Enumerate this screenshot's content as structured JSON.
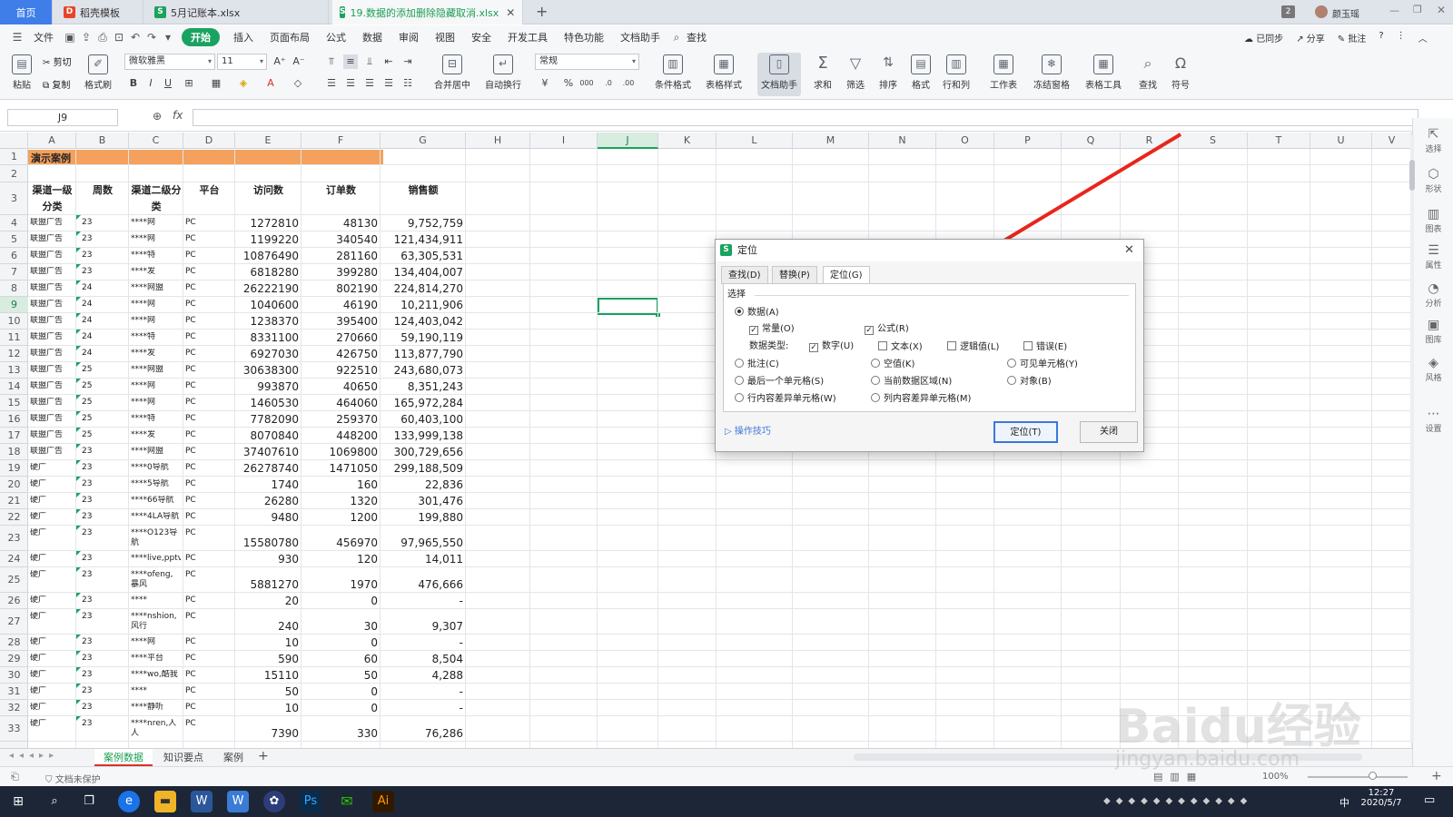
{
  "window_tabs": [
    {
      "label": "首页"
    },
    {
      "label": "稻壳模板"
    },
    {
      "label": "5月记账本.xlsx"
    },
    {
      "label": "19.数据的添加删除隐藏取消.xlsx"
    }
  ],
  "titlebar": {
    "badge": "2",
    "user": "颜玉瑶"
  },
  "menus": [
    "文件",
    "开始",
    "插入",
    "页面布局",
    "公式",
    "数据",
    "审阅",
    "视图",
    "安全",
    "开发工具",
    "特色功能",
    "文档助手",
    "查找"
  ],
  "menu_right": {
    "sync": "已同步",
    "share": "分享",
    "annotate": "批注"
  },
  "ribbon": {
    "paste": "粘贴",
    "cut": "剪切",
    "copy": "复制",
    "format_painter": "格式刷",
    "font_name": "微软雅黑",
    "font_size": "11",
    "number_format": "常规",
    "merge": "合并居中",
    "wrap": "自动换行",
    "cond_format": "条件格式",
    "table_style": "表格样式",
    "doc_assistant": "文档助手",
    "sum": "求和",
    "filter": "筛选",
    "sort": "排序",
    "format": "格式",
    "row_col": "行和列",
    "worksheet": "工作表",
    "freeze": "冻结窗格",
    "table_tools": "表格工具",
    "find": "查找",
    "symbol": "符号"
  },
  "formula_bar": {
    "name_box": "J9",
    "fx": "fx",
    "formula": ""
  },
  "columns": [
    "A",
    "B",
    "C",
    "D",
    "E",
    "F",
    "G",
    "H",
    "I",
    "J",
    "K",
    "L",
    "M",
    "N",
    "O",
    "P",
    "Q",
    "R",
    "S",
    "T",
    "U",
    "V"
  ],
  "selected_col": "J",
  "selected_row": "9",
  "banner": "演示案例",
  "headers": {
    "a": "渠道一级分类",
    "b": "周数",
    "c": "渠道二级分类",
    "d": "平台",
    "e": "访问数",
    "f": "订单数",
    "g": "销售额"
  },
  "rows": [
    {
      "r": "4",
      "a": "联盟广告",
      "b": "23",
      "c": "****网",
      "d": "PC",
      "e": "1272810",
      "f": "48130",
      "g": "9,752,759"
    },
    {
      "r": "5",
      "a": "联盟广告",
      "b": "23",
      "c": "****网",
      "d": "PC",
      "e": "1199220",
      "f": "340540",
      "g": "121,434,911"
    },
    {
      "r": "6",
      "a": "联盟广告",
      "b": "23",
      "c": "****特",
      "d": "PC",
      "e": "10876490",
      "f": "281160",
      "g": "63,305,531"
    },
    {
      "r": "7",
      "a": "联盟广告",
      "b": "23",
      "c": "****发",
      "d": "PC",
      "e": "6818280",
      "f": "399280",
      "g": "134,404,007"
    },
    {
      "r": "8",
      "a": "联盟广告",
      "b": "24",
      "c": "****网盟",
      "d": "PC",
      "e": "26222190",
      "f": "802190",
      "g": "224,814,270"
    },
    {
      "r": "9",
      "a": "联盟广告",
      "b": "24",
      "c": "****网",
      "d": "PC",
      "e": "1040600",
      "f": "46190",
      "g": "10,211,906"
    },
    {
      "r": "10",
      "a": "联盟广告",
      "b": "24",
      "c": "****网",
      "d": "PC",
      "e": "1238370",
      "f": "395400",
      "g": "124,403,042"
    },
    {
      "r": "11",
      "a": "联盟广告",
      "b": "24",
      "c": "****特",
      "d": "PC",
      "e": "8331100",
      "f": "270660",
      "g": "59,190,119"
    },
    {
      "r": "12",
      "a": "联盟广告",
      "b": "24",
      "c": "****发",
      "d": "PC",
      "e": "6927030",
      "f": "426750",
      "g": "113,877,790"
    },
    {
      "r": "13",
      "a": "联盟广告",
      "b": "25",
      "c": "****网盟",
      "d": "PC",
      "e": "30638300",
      "f": "922510",
      "g": "243,680,073"
    },
    {
      "r": "14",
      "a": "联盟广告",
      "b": "25",
      "c": "****网",
      "d": "PC",
      "e": "993870",
      "f": "40650",
      "g": "8,351,243"
    },
    {
      "r": "15",
      "a": "联盟广告",
      "b": "25",
      "c": "****网",
      "d": "PC",
      "e": "1460530",
      "f": "464060",
      "g": "165,972,284"
    },
    {
      "r": "16",
      "a": "联盟广告",
      "b": "25",
      "c": "****特",
      "d": "PC",
      "e": "7782090",
      "f": "259370",
      "g": "60,403,100"
    },
    {
      "r": "17",
      "a": "联盟广告",
      "b": "25",
      "c": "****发",
      "d": "PC",
      "e": "8070840",
      "f": "448200",
      "g": "133,999,138"
    },
    {
      "r": "18",
      "a": "联盟广告",
      "b": "23",
      "c": "****网盟",
      "d": "PC",
      "e": "37407610",
      "f": "1069800",
      "g": "300,729,656"
    },
    {
      "r": "19",
      "a": "硬广",
      "b": "23",
      "c": "****0导航",
      "d": "PC",
      "e": "26278740",
      "f": "1471050",
      "g": "299,188,509"
    },
    {
      "r": "20",
      "a": "硬广",
      "b": "23",
      "c": "****5导航",
      "d": "PC",
      "e": "1740",
      "f": "160",
      "g": "22,836"
    },
    {
      "r": "21",
      "a": "硬广",
      "b": "23",
      "c": "****66导航",
      "d": "PC",
      "e": "26280",
      "f": "1320",
      "g": "301,476"
    },
    {
      "r": "22",
      "a": "硬广",
      "b": "23",
      "c": "****4LA导航",
      "d": "PC",
      "e": "9480",
      "f": "1200",
      "g": "199,880"
    },
    {
      "r": "23",
      "a": "硬广",
      "b": "23",
      "c": "****O123导航",
      "d": "PC",
      "e": "15580780",
      "f": "456970",
      "g": "97,965,550"
    },
    {
      "r": "24",
      "a": "硬广",
      "b": "23",
      "c": "****live,pptv",
      "d": "PC",
      "e": "930",
      "f": "120",
      "g": "14,011"
    },
    {
      "r": "25",
      "a": "硬广",
      "b": "23",
      "c": "****ofeng,暴风",
      "d": "PC",
      "e": "5881270",
      "f": "1970",
      "g": "476,666"
    },
    {
      "r": "26",
      "a": "硬广",
      "b": "23",
      "c": "****",
      "d": "PC",
      "e": "20",
      "f": "0",
      "g": "-"
    },
    {
      "r": "27",
      "a": "硬广",
      "b": "23",
      "c": "****nshion,风行",
      "d": "PC",
      "e": "240",
      "f": "30",
      "g": "9,307"
    },
    {
      "r": "28",
      "a": "硬广",
      "b": "23",
      "c": "****网",
      "d": "PC",
      "e": "10",
      "f": "0",
      "g": "-"
    },
    {
      "r": "29",
      "a": "硬广",
      "b": "23",
      "c": "****平台",
      "d": "PC",
      "e": "590",
      "f": "60",
      "g": "8,504"
    },
    {
      "r": "30",
      "a": "硬广",
      "b": "23",
      "c": "****wo,酷我",
      "d": "PC",
      "e": "15110",
      "f": "50",
      "g": "4,288"
    },
    {
      "r": "31",
      "a": "硬广",
      "b": "23",
      "c": "****",
      "d": "PC",
      "e": "50",
      "f": "0",
      "g": "-"
    },
    {
      "r": "32",
      "a": "硬广",
      "b": "23",
      "c": "****静听",
      "d": "PC",
      "e": "10",
      "f": "0",
      "g": "-"
    },
    {
      "r": "33",
      "a": "硬广",
      "b": "23",
      "c": "****nren,人人",
      "d": "PC",
      "e": "7390",
      "f": "330",
      "g": "76,286"
    }
  ],
  "sheet_tabs": [
    "案例数据",
    "知识要点",
    "案例"
  ],
  "status": {
    "protect": "文档未保护",
    "zoom": "100%"
  },
  "right_panel": [
    "选择",
    "形状",
    "图表",
    "属性",
    "分析",
    "图库",
    "风格",
    "设置"
  ],
  "dialog": {
    "title": "定位",
    "tabs": [
      "查找(D)",
      "替换(P)",
      "定位(G)"
    ],
    "section": "选择",
    "opt_data": "数据(A)",
    "opt_constant": "常量(O)",
    "opt_formula": "公式(R)",
    "data_type_label": "数据类型:",
    "opt_number": "数字(U)",
    "opt_text": "文本(X)",
    "opt_logical": "逻辑值(L)",
    "opt_error": "错误(E)",
    "opt_comment": "批注(C)",
    "opt_blank": "空值(K)",
    "opt_visible": "可见单元格(Y)",
    "opt_last": "最后一个单元格(S)",
    "opt_region": "当前数据区域(N)",
    "opt_object": "对象(B)",
    "opt_rowdiff": "行内容差异单元格(W)",
    "opt_coldiff": "列内容差异单元格(M)",
    "tips": "操作技巧",
    "ok": "定位(T)",
    "close": "关闭"
  },
  "taskbar": {
    "time": "12:27",
    "date": "2020/5/7",
    "ime": "中"
  },
  "watermark": {
    "text": "Baidu经验",
    "url": "jingyan.baidu.com"
  },
  "colors": {
    "accent": "#1aa260",
    "banner": "#f4a15d",
    "arrow": "#e8261c",
    "tab_home": "#3f7ee8"
  }
}
